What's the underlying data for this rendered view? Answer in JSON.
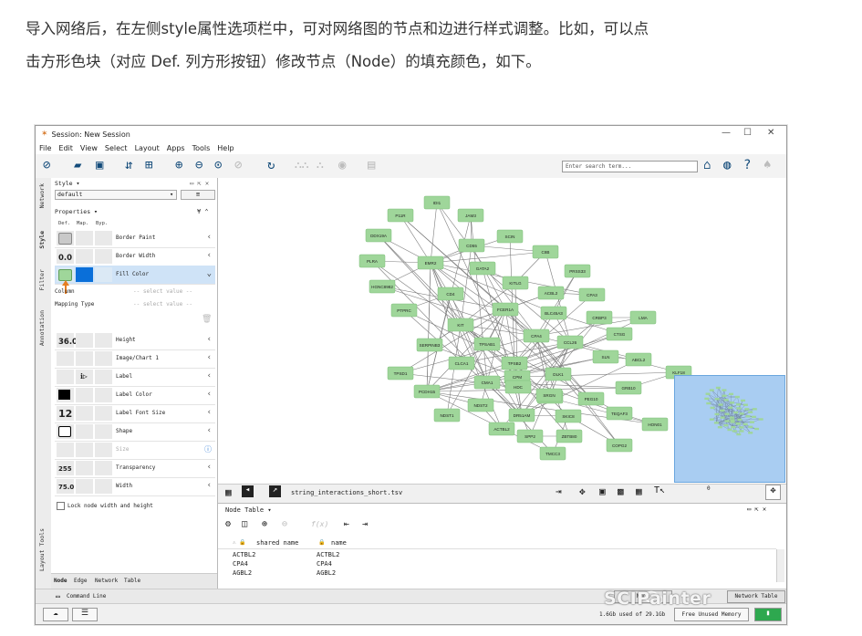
{
  "article": {
    "line1": "导入网络后，在左侧style属性选项栏中，可对网络图的节点和边进行样式调整。比如，可以点",
    "line2": "击方形色块（对应 Def. 列方形按钮）修改节点（Node）的填充颜色，如下。"
  },
  "window": {
    "title": "Session: New Session",
    "controls": [
      "—",
      "☐",
      "✕"
    ]
  },
  "menu": [
    "File",
    "Edit",
    "View",
    "Select",
    "Layout",
    "Apps",
    "Tools",
    "Help"
  ],
  "toolbar": {
    "search_placeholder": "Enter search term..."
  },
  "side_tabs": [
    "Network",
    "Style",
    "Filter",
    "Annotation",
    "Layout Tools"
  ],
  "style_panel": {
    "header": "Style ▾",
    "style_name": "default",
    "properties_header": "Properties ▾",
    "columns": [
      "Def.",
      "Map.",
      "Byp."
    ],
    "rows_top": [
      {
        "label": "Border Paint",
        "value": ""
      },
      {
        "label": "Border Width",
        "value": "0.0"
      },
      {
        "label": "Fill Color",
        "value": ""
      }
    ],
    "mapping": {
      "column_label": "Column",
      "column_value": "-- select value --",
      "type_label": "Mapping Type",
      "type_value": "-- select value --"
    },
    "rows_bottom": [
      {
        "label": "Height",
        "value": "36.0"
      },
      {
        "label": "Image/Chart 1",
        "value": ""
      },
      {
        "label": "Label",
        "value": ""
      },
      {
        "label": "Label Color",
        "value": ""
      },
      {
        "label": "Label Font Size",
        "value": "12"
      },
      {
        "label": "Shape",
        "value": ""
      },
      {
        "label": "Size",
        "value": ""
      },
      {
        "label": "Transparency",
        "value": "255"
      },
      {
        "label": "Width",
        "value": "75.0"
      }
    ],
    "lock_label": "Lock node width and height",
    "bottom_tabs": [
      "Node",
      "Edge",
      "Network",
      "Table"
    ]
  },
  "colors": {
    "node_fill": "#9fd69a",
    "node_border": "#7fbf7a",
    "edge": "#7d7d7d",
    "selected_fill": "#0a6fd9",
    "overview_bg": "#a9cdf2"
  },
  "network": {
    "nodes": [
      "IDI1",
      "P11R",
      "JAM3",
      "DDX19A",
      "CD55",
      "SCIN",
      "PLRA",
      "EMR2",
      "C8B",
      "GATA2",
      "PRSS33",
      "HGNC8982",
      "CD4",
      "KITLG",
      "ACBL2",
      "CPA3",
      "PTPRC",
      "FCER1A",
      "BLC45A3",
      "CRBP3",
      "LMA",
      "KIT",
      "CTSG",
      "SERPINB3",
      "TPSAB1",
      "CPA4",
      "CCL26",
      "SLN",
      "CLCA1",
      "ABCL2",
      "KLF18",
      "TPSD1",
      "CMA1",
      "TPSB2",
      "CPM",
      "DLK1",
      "HDC",
      "GRB10",
      "PCDH15",
      "TPSD1",
      "SRGN",
      "PEG10",
      "NDST2",
      "TEQAF3",
      "NDST1",
      "DR51AM",
      "SKIC8",
      "HON01",
      "ACTBL2",
      "SPP2",
      "ZBTB80",
      "COPG2",
      "TMCC3"
    ],
    "table_file": "string_interactions_short.tsv"
  },
  "node_table": {
    "title": "Node Table ▾",
    "columns": [
      "shared name",
      "name"
    ],
    "rows": [
      [
        "ACTBL2",
        "ACTBL2"
      ],
      [
        "CPA4",
        "CPA4"
      ],
      [
        "AGBL2",
        "AGBL2"
      ]
    ]
  },
  "command_line": "Command Line",
  "status": {
    "memory": "1.6Gb used of 29.1Gb",
    "free_memory": "Free Unused Memory",
    "node_tab": "Node",
    "network_table_tab": "Network Table"
  },
  "watermark": "SCIPainter"
}
